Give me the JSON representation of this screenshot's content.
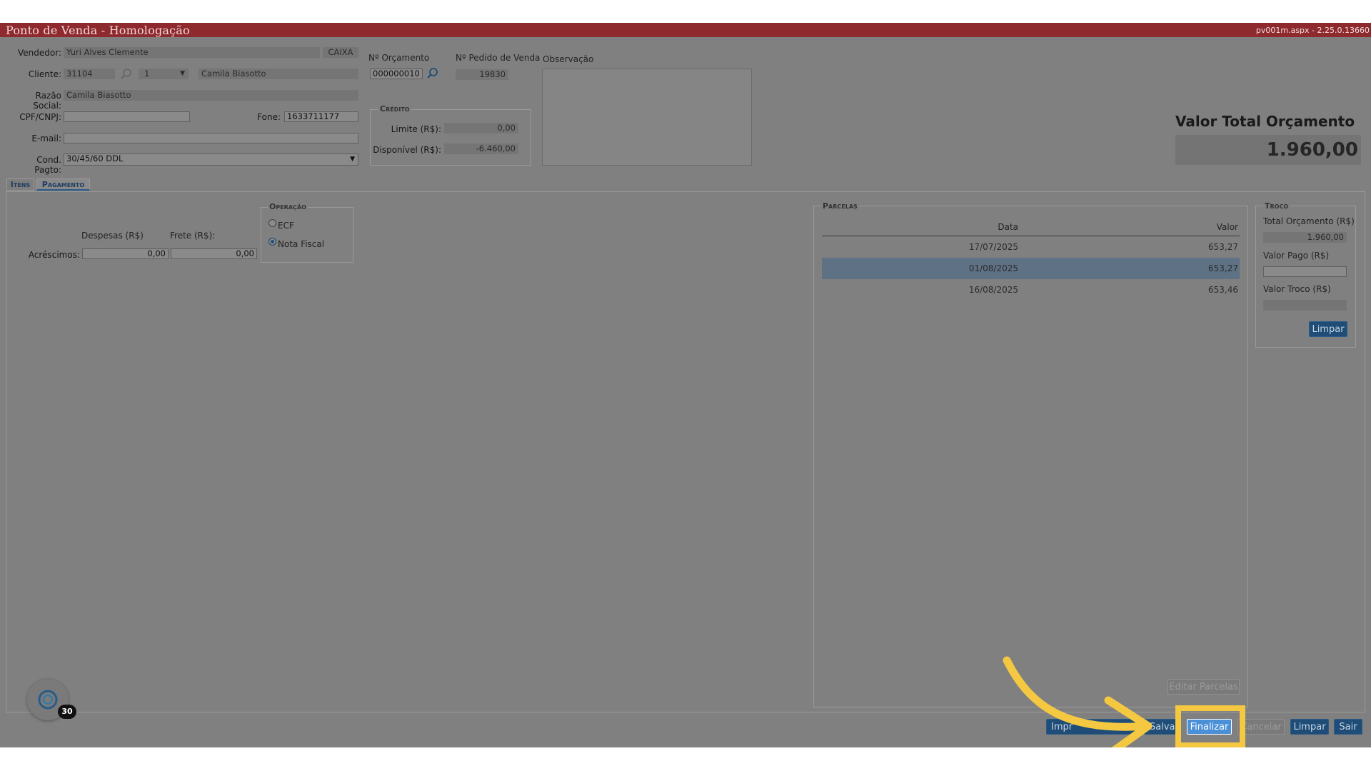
{
  "window": {
    "title": "Ponto de Venda  - Homologação",
    "version": "pv001m.aspx - 2.25.0.13660"
  },
  "header": {
    "vendedor_label": "Vendedor:",
    "vendedor_value": "Yuri Alves Clemente",
    "caixa_value": "CAIXA",
    "cliente_label": "Cliente:",
    "cliente_code": "31104",
    "cliente_select": "1",
    "cliente_name": "Camila Biasotto",
    "razao_label": "Razão Social:",
    "razao_value": "Camila Biasotto",
    "cpf_label": "CPF/CNPJ:",
    "cpf_value": "",
    "fone_label": "Fone:",
    "fone_value": "1633711177",
    "email_label": "E-mail:",
    "email_value": "",
    "cond_label": "Cond. Pagto:",
    "cond_value": "30/45/60 DDL",
    "orcamento_label": "Nº Orçamento",
    "orcamento_value": "000000010",
    "pedido_label": "Nº Pedido de Venda",
    "pedido_value": "19830",
    "observacao_label": "Observação",
    "credito_legend": "Crédito",
    "limite_label": "Limite (R$):",
    "limite_value": "0,00",
    "disponivel_label": "Disponível (R$):",
    "disponivel_value": "-6.460,00",
    "total_label": "Valor Total Orçamento",
    "total_value": "1.960,00"
  },
  "tabs": [
    {
      "label": "Itens",
      "active": false
    },
    {
      "label": "Pagamento",
      "active": true
    }
  ],
  "pagamento": {
    "despesas_label": "Despesas (R$)",
    "frete_label": "Frete (R$):",
    "acrescimos_label": "Acréscimos:",
    "despesas_value": "0,00",
    "frete_value": "0,00",
    "operacao_legend": "Operação",
    "op_ecf": "ECF",
    "op_nf": "Nota Fiscal",
    "op_selected": "Nota Fiscal"
  },
  "parcelas": {
    "legend": "Parcelas",
    "col_data": "Data",
    "col_valor": "Valor",
    "rows": [
      {
        "data": "17/07/2025",
        "valor": "653,27",
        "selected": false
      },
      {
        "data": "01/08/2025",
        "valor": "653,27",
        "selected": true
      },
      {
        "data": "16/08/2025",
        "valor": "653,46",
        "selected": false
      }
    ],
    "editar_label": "Editar Parcelas"
  },
  "troco": {
    "legend": "Troco",
    "total_label": "Total Orçamento (R$)",
    "total_value": "1.960,00",
    "pago_label": "Valor Pago (R$)",
    "pago_value": "",
    "troco_label": "Valor Troco (R$)",
    "troco_value": "",
    "limpar_label": "Limpar"
  },
  "footer": {
    "imprimir_label": "Impr",
    "salvar_label": "Salva",
    "finalizar_label": "Finalizar",
    "cancelar_label": "Cancelar",
    "limpar_label": "Limpar",
    "sair_label": "Sair",
    "badge_count": "30"
  },
  "colors": {
    "titlebar": "#8e2a2e",
    "highlight": "#f5c842",
    "button": "#1f4d78",
    "focus_button": "#4a90d6"
  }
}
